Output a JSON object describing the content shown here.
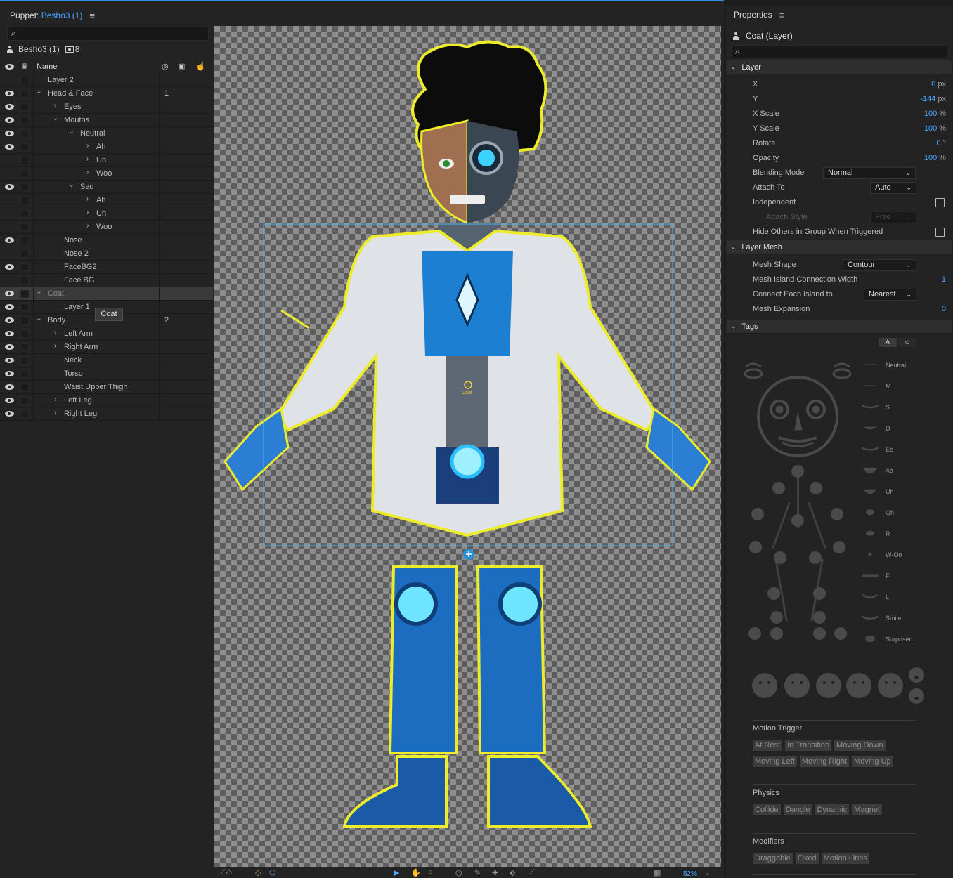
{
  "puppet_panel": {
    "title_prefix": "Puppet:",
    "title_name": "Besho3 (1)",
    "puppet_name": "Besho3 (1)",
    "badge_count": "8",
    "column_name": "Name",
    "tooltip": "Coat"
  },
  "layers": [
    {
      "name": "Layer 2",
      "tag": "",
      "eye": false,
      "indent": 0,
      "chevron": "none",
      "dim": false
    },
    {
      "name": "Head & Face",
      "tag": "1",
      "eye": true,
      "indent": 0,
      "chevron": "open",
      "dim": false
    },
    {
      "name": "Eyes",
      "tag": "",
      "eye": true,
      "indent": 1,
      "chevron": "closed",
      "dim": false
    },
    {
      "name": "Mouths",
      "tag": "",
      "eye": true,
      "indent": 1,
      "chevron": "open",
      "dim": false
    },
    {
      "name": "Neutral",
      "tag": "",
      "eye": true,
      "indent": 2,
      "chevron": "open",
      "dim": false
    },
    {
      "name": "Ah",
      "tag": "",
      "eye": true,
      "indent": 3,
      "chevron": "closed",
      "dim": false
    },
    {
      "name": "Uh",
      "tag": "",
      "eye": false,
      "indent": 3,
      "chevron": "closed",
      "dim": false
    },
    {
      "name": "Woo",
      "tag": "",
      "eye": false,
      "indent": 3,
      "chevron": "closed",
      "dim": false
    },
    {
      "name": "Sad",
      "tag": "",
      "eye": true,
      "indent": 2,
      "chevron": "open",
      "dim": false
    },
    {
      "name": "Ah",
      "tag": "",
      "eye": false,
      "indent": 3,
      "chevron": "closed",
      "dim": false
    },
    {
      "name": "Uh",
      "tag": "",
      "eye": false,
      "indent": 3,
      "chevron": "closed",
      "dim": false
    },
    {
      "name": "Woo",
      "tag": "",
      "eye": false,
      "indent": 3,
      "chevron": "closed",
      "dim": false
    },
    {
      "name": "Nose",
      "tag": "",
      "eye": true,
      "indent": 1,
      "chevron": "none",
      "dim": false
    },
    {
      "name": "Nose 2",
      "tag": "",
      "eye": false,
      "indent": 1,
      "chevron": "none",
      "dim": false
    },
    {
      "name": "FaceBG2",
      "tag": "",
      "eye": true,
      "indent": 1,
      "chevron": "none",
      "dim": false
    },
    {
      "name": "Face BG",
      "tag": "",
      "eye": false,
      "indent": 1,
      "chevron": "none",
      "dim": false
    },
    {
      "name": "Coat",
      "tag": "",
      "eye": true,
      "indent": 0,
      "chevron": "open",
      "dim": true,
      "selected": true
    },
    {
      "name": "Layer 1",
      "tag": "",
      "eye": true,
      "indent": 1,
      "chevron": "none",
      "dim": false
    },
    {
      "name": "Body",
      "tag": "2",
      "eye": true,
      "indent": 0,
      "chevron": "open",
      "dim": false
    },
    {
      "name": "Left Arm",
      "tag": "",
      "eye": true,
      "indent": 1,
      "chevron": "closed",
      "dim": false
    },
    {
      "name": "Right Arm",
      "tag": "",
      "eye": true,
      "indent": 1,
      "chevron": "closed",
      "dim": false
    },
    {
      "name": "Neck",
      "tag": "",
      "eye": true,
      "indent": 1,
      "chevron": "none",
      "dim": false
    },
    {
      "name": "Torso",
      "tag": "",
      "eye": true,
      "indent": 1,
      "chevron": "none",
      "dim": false
    },
    {
      "name": "Waist Upper Thigh",
      "tag": "",
      "eye": true,
      "indent": 1,
      "chevron": "none",
      "dim": false
    },
    {
      "name": "Left Leg",
      "tag": "",
      "eye": true,
      "indent": 1,
      "chevron": "closed",
      "dim": false
    },
    {
      "name": "Right Leg",
      "tag": "",
      "eye": true,
      "indent": 1,
      "chevron": "closed",
      "dim": false
    }
  ],
  "canvas": {
    "handle_label": "Coat",
    "zoom": "52%"
  },
  "properties": {
    "title": "Properties",
    "layer_name": "Coat (Layer)",
    "sections": {
      "layer": "Layer",
      "layer_mesh": "Layer Mesh",
      "tags": "Tags"
    },
    "layer": {
      "x_label": "X",
      "x_value": "0",
      "x_unit": "px",
      "y_label": "Y",
      "y_value": "-144",
      "y_unit": "px",
      "xscale_label": "X Scale",
      "xscale_value": "100",
      "xscale_unit": "%",
      "yscale_label": "Y Scale",
      "yscale_value": "100",
      "yscale_unit": "%",
      "rotate_label": "Rotate",
      "rotate_value": "0",
      "rotate_unit": "°",
      "opacity_label": "Opacity",
      "opacity_value": "100",
      "opacity_unit": "%",
      "blend_label": "Blending Mode",
      "blend_value": "Normal",
      "attach_label": "Attach To",
      "attach_value": "Auto",
      "independent_label": "Independent",
      "attach_style_label": "Attach Style",
      "attach_style_value": "Free",
      "hide_others_label": "Hide Others in Group When Triggered"
    },
    "mesh": {
      "shape_label": "Mesh Shape",
      "shape_value": "Contour",
      "island_width_label": "Mesh Island Connection Width",
      "island_width_value": "1",
      "connect_label": "Connect Each Island to",
      "connect_value": "Nearest",
      "expansion_label": "Mesh Expansion",
      "expansion_value": "0"
    },
    "tags": {
      "toggle_a": "A",
      "toggle_b": "☺",
      "visemes": [
        "Neutral",
        "M",
        "S",
        "D",
        "Ee",
        "Aa",
        "Uh",
        "Oh",
        "R",
        "W-Oo",
        "F",
        "L",
        "Smile",
        "Surprised"
      ],
      "motion_trigger_title": "Motion Trigger",
      "motion_trigger_chips": [
        [
          "At Rest",
          "In Transition",
          "Moving Down"
        ],
        [
          "Moving Left",
          "Moving Right",
          "Moving Up"
        ]
      ],
      "physics_title": "Physics",
      "physics_chips": [
        "Collide",
        "Dangle",
        "Dynamic",
        "Magnet"
      ],
      "modifiers_title": "Modifiers",
      "modifiers_chips": [
        "Draggable",
        "Fixed",
        "Motion Lines"
      ]
    }
  }
}
